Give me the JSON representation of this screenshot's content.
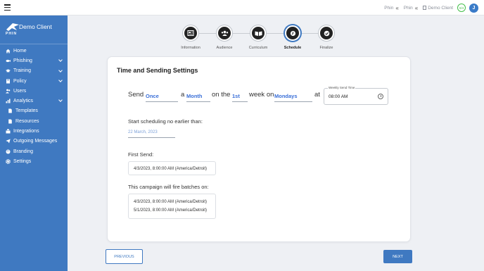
{
  "topbar": {
    "crumbs": [
      {
        "label": "Phin",
        "icon": "chevrons-left-icon"
      },
      {
        "label": "Phin",
        "icon": "chevrons-left-icon"
      },
      {
        "label": "Demo Client",
        "icon": "document-icon"
      }
    ],
    "badge": "0/4",
    "avatar_initial": "J"
  },
  "sidebar": {
    "logo_text": "PHIN",
    "brand_name": "Demo Client",
    "items": [
      {
        "label": "Home",
        "icon": "home-icon",
        "expandable": false,
        "sub": false
      },
      {
        "label": "Phishing",
        "icon": "fish-icon",
        "expandable": true,
        "sub": false
      },
      {
        "label": "Training",
        "icon": "graduation-cap-icon",
        "expandable": true,
        "sub": false
      },
      {
        "label": "Policy",
        "icon": "book-icon",
        "expandable": true,
        "sub": false
      },
      {
        "label": "Users",
        "icon": "users-icon",
        "expandable": false,
        "sub": false
      },
      {
        "label": "Analytics",
        "icon": "chart-icon",
        "expandable": true,
        "sub": false
      },
      {
        "label": "Templates",
        "icon": "file-icon",
        "expandable": false,
        "sub": true
      },
      {
        "label": "Resources",
        "icon": "file-icon",
        "expandable": false,
        "sub": true
      },
      {
        "label": "Integrations",
        "icon": "plug-icon",
        "expandable": false,
        "sub": false
      },
      {
        "label": "Outgoing Messages",
        "icon": "send-icon",
        "expandable": false,
        "sub": false
      },
      {
        "label": "Branding",
        "icon": "palette-icon",
        "expandable": false,
        "sub": false
      },
      {
        "label": "Settings",
        "icon": "gear-icon",
        "expandable": false,
        "sub": false
      }
    ]
  },
  "stepper": {
    "steps": [
      {
        "label": "Information",
        "icon": "newspaper-icon",
        "active": false
      },
      {
        "label": "Audience",
        "icon": "users-icon",
        "active": false
      },
      {
        "label": "Curriculum",
        "icon": "open-book-icon",
        "active": false
      },
      {
        "label": "Schedule",
        "icon": "clock-icon",
        "active": true
      },
      {
        "label": "Finalize",
        "icon": "check-circle-icon",
        "active": false
      }
    ]
  },
  "card": {
    "title": "Time and Sending Settings",
    "sentence": {
      "w_send": "Send",
      "frequency": "Once",
      "w_a": "a",
      "period": "Month",
      "w_on_the": "on the",
      "ordinal": "1st",
      "w_week_on": "week on",
      "weekday": "Mondays",
      "w_at": "at"
    },
    "time_field": {
      "label": "Weekly Send Time",
      "value": "08:00 AM"
    },
    "start_label": "Start scheduling no earlier than:",
    "start_date": "22 March, 2023",
    "first_send_label": "First Send:",
    "first_send_value": "4/3/2023, 8:00:00 AM (America/Detroit)",
    "batches_label": "This campaign will fire batches on:",
    "batches": [
      "4/3/2023, 8:00:00 AM (America/Detroit)",
      "5/1/2023, 8:00:00 AM (America/Detroit)"
    ]
  },
  "footer": {
    "previous_label": "PREVIOUS",
    "next_label": "NEXT"
  },
  "colors": {
    "primary": "#3f79c1",
    "link": "#3a6fd8",
    "badge_green": "#44c04a"
  }
}
